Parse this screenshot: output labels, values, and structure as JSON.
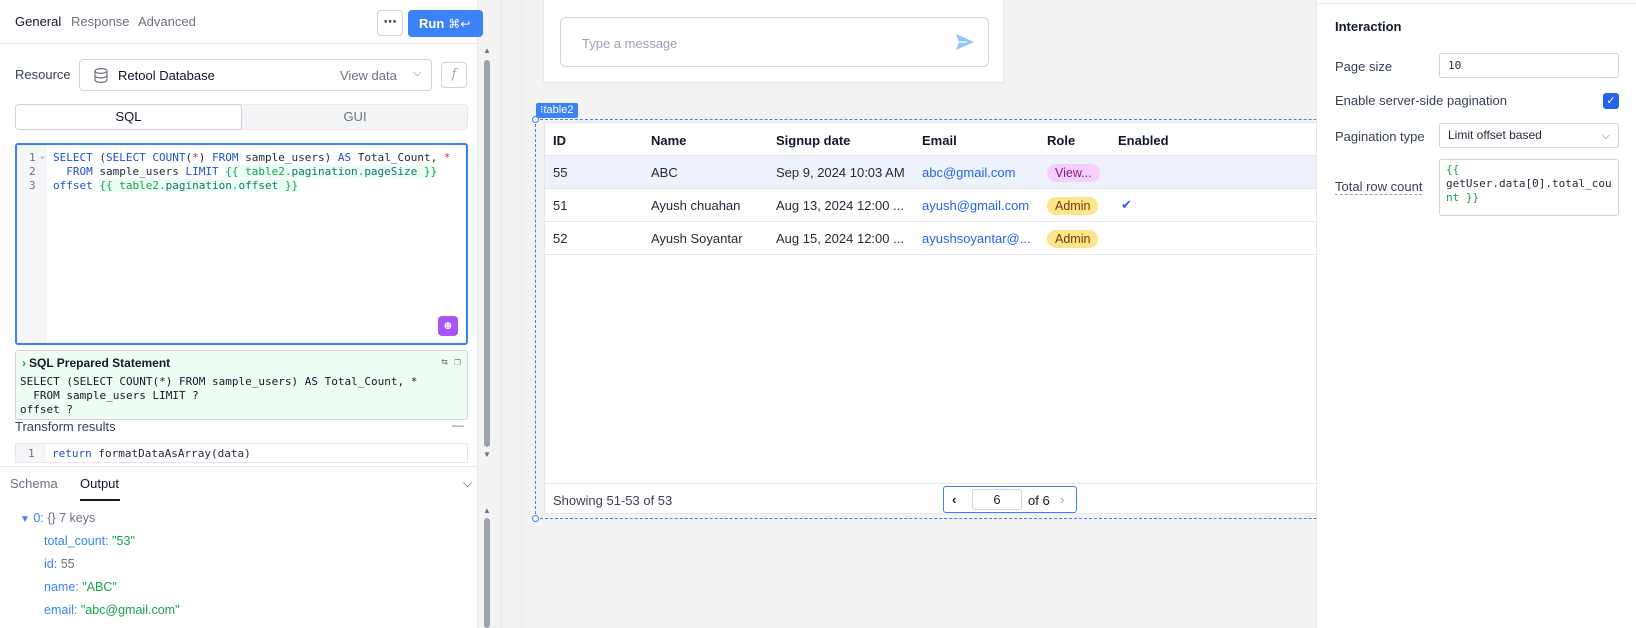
{
  "query_editor": {
    "tabs": [
      "General",
      "Response",
      "Advanced"
    ],
    "more_label": "⋯",
    "run_label": "Run",
    "run_shortcut": "⌘↩",
    "resource_label": "Resource",
    "resource_name": "Retool Database",
    "view_data_label": "View data",
    "fx_label": "f",
    "mode_options": [
      "SQL",
      "GUI"
    ],
    "code_line_numbers": [
      "1",
      "2",
      "3"
    ],
    "prepared": {
      "title": "SQL Prepared Statement",
      "lines": [
        "SELECT (SELECT COUNT(*) FROM sample_users) AS Total_Count, *",
        "  FROM sample_users LIMIT ?",
        "offset ?"
      ]
    },
    "transform_label": "Transform results",
    "transform_line_number": "1",
    "transform_code": "return formatDataAsArray(data)"
  },
  "output_panel": {
    "tabs": [
      "Schema",
      "Output"
    ],
    "root_key": "0:",
    "root_meta": "{}  7 keys",
    "fields": [
      {
        "key": "total_count:",
        "value": "\"53\"",
        "type": "str"
      },
      {
        "key": "id:",
        "value": "55",
        "type": "num"
      },
      {
        "key": "name:",
        "value": "\"ABC\"",
        "type": "str"
      },
      {
        "key": "email:",
        "value": "\"abc@gmail.com\"",
        "type": "str"
      }
    ]
  },
  "chat": {
    "placeholder": "Type a message"
  },
  "table": {
    "component_name": "table2",
    "columns": [
      "ID",
      "Name",
      "Signup date",
      "Email",
      "Role",
      "Enabled"
    ],
    "rows": [
      {
        "id": "55",
        "name": "ABC",
        "signup": "Sep 9, 2024 10:03 AM",
        "email": "abc@gmail.com",
        "role": "View...",
        "role_type": "view",
        "enabled": false
      },
      {
        "id": "51",
        "name": "Ayush chuahan",
        "signup": "Aug 13, 2024 12:00 ...",
        "email": "ayush@gmail.com",
        "role": "Admin",
        "role_type": "admin",
        "enabled": true
      },
      {
        "id": "52",
        "name": "Ayush Soyantar",
        "signup": "Aug 15, 2024 12:00 ...",
        "email": "ayushsoyantar@...",
        "role": "Admin",
        "role_type": "admin",
        "enabled": false
      }
    ],
    "showing": "Showing 51-53 of 53",
    "page": "6",
    "page_of": "of 6"
  },
  "inspector": {
    "section": "Interaction",
    "page_size_label": "Page size",
    "page_size_value": "10",
    "server_pagination_label": "Enable server-side pagination",
    "server_pagination_checked": true,
    "pagination_type_label": "Pagination type",
    "pagination_type_value": "Limit offset based",
    "total_row_label": "Total row count",
    "total_row_value_lines": [
      "{{",
      "getUser.data[0].total_cou",
      "nt }}"
    ]
  },
  "colors": {
    "accent": "#3b82f6",
    "success": "#16a34a",
    "admin_badge": "#fde68a",
    "view_badge": "#f5d0fe"
  }
}
